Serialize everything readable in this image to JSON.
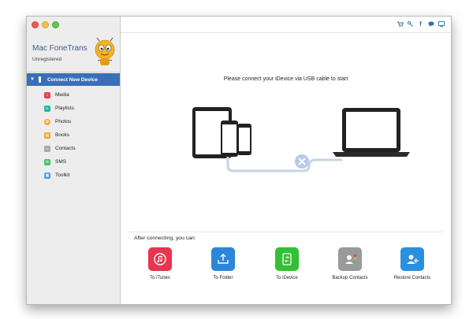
{
  "app": {
    "title": "Mac FoneTrans",
    "status": "Unregistered"
  },
  "sidebar": {
    "device_label": "Connect New Device",
    "items": [
      {
        "label": "Media",
        "icon": "media-icon",
        "color": "#e8434d"
      },
      {
        "label": "Playlists",
        "icon": "playlists-icon",
        "color": "#27b5a8"
      },
      {
        "label": "Photos",
        "icon": "photos-icon",
        "color": "#f2a93b"
      },
      {
        "label": "Books",
        "icon": "books-icon",
        "color": "#f0a23a"
      },
      {
        "label": "Contacts",
        "icon": "contacts-icon",
        "color": "#a7a7a7"
      },
      {
        "label": "SMS",
        "icon": "sms-icon",
        "color": "#3cc46a"
      },
      {
        "label": "Toolkit",
        "icon": "toolkit-icon",
        "color": "#4da2dc"
      }
    ]
  },
  "topbar": {
    "icons": [
      "cart-icon",
      "key-icon",
      "facebook-icon",
      "chat-icon",
      "screen-icon"
    ]
  },
  "main": {
    "message": "Please connect your iDevice via USB cable to start",
    "after_label": "After connecting, you can:",
    "actions": [
      {
        "label": "To iTunes",
        "icon": "itunes-icon",
        "color": "#e8344f"
      },
      {
        "label": "To Folder",
        "icon": "folder-export-icon",
        "color": "#2b86d9"
      },
      {
        "label": "To iDevice",
        "icon": "idevice-transfer-icon",
        "color": "#33c034"
      },
      {
        "label": "Backup Contacts",
        "icon": "backup-contacts-icon",
        "color": "#9a9a9a"
      },
      {
        "label": "Restore Contacts",
        "icon": "restore-contacts-icon",
        "color": "#2b8fe0"
      }
    ]
  }
}
